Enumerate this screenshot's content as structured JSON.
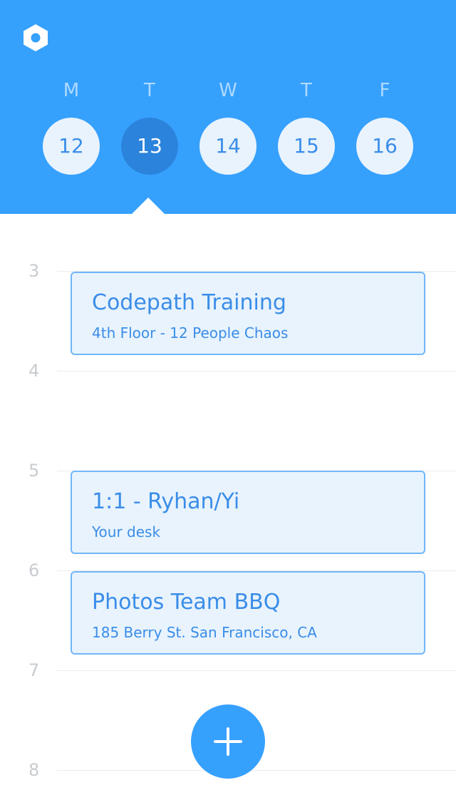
{
  "header": {
    "accent_color": "#36a0fd",
    "logo_icon": "hexagon-icon",
    "days": [
      {
        "letter": "M",
        "date": "12",
        "selected": false
      },
      {
        "letter": "T",
        "date": "13",
        "selected": true
      },
      {
        "letter": "W",
        "date": "14",
        "selected": false
      },
      {
        "letter": "T",
        "date": "15",
        "selected": false
      },
      {
        "letter": "F",
        "date": "16",
        "selected": false
      }
    ]
  },
  "timeline": {
    "hours": [
      "3",
      "4",
      "5",
      "6",
      "7",
      "8"
    ]
  },
  "events": [
    {
      "title": "Codepath Training",
      "subtitle": "4th Floor - 12 People Chaos"
    },
    {
      "title": "1:1 - Ryhan/Yi",
      "subtitle": "Your desk"
    },
    {
      "title": "Photos Team BBQ",
      "subtitle": "185 Berry St. San Francisco, CA"
    }
  ],
  "fab": {
    "icon": "plus-icon"
  }
}
